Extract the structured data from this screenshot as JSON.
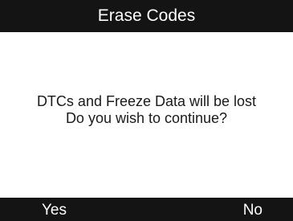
{
  "dialog": {
    "title": "Erase Codes",
    "message_line1": "DTCs and Freeze Data will be lost",
    "message_line2": "Do you wish to continue?"
  },
  "footer": {
    "yes_label": "Yes",
    "no_label": "No"
  },
  "colors": {
    "bar_background": "#141414",
    "bar_text": "#ffffff",
    "content_background": "#ffffff",
    "content_text": "#1a1a1a"
  }
}
